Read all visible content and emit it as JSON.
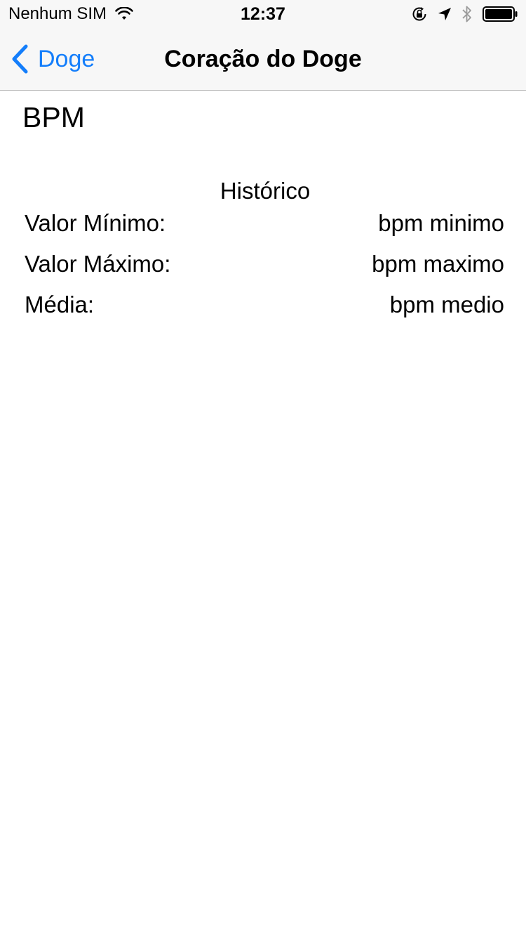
{
  "status_bar": {
    "carrier": "Nenhum SIM",
    "time": "12:37",
    "icons": [
      "wifi-icon",
      "orientation-lock-icon",
      "location-arrow-icon",
      "bluetooth-icon",
      "battery-icon"
    ]
  },
  "nav": {
    "back_label": "Doge",
    "title": "Coração do Doge",
    "accent_color": "#147efb"
  },
  "main": {
    "bpm_label": "BPM",
    "history_title": "Histórico",
    "rows": [
      {
        "label": "Valor Mínimo:",
        "value": "bpm minimo"
      },
      {
        "label": "Valor Máximo:",
        "value": "bpm maximo"
      },
      {
        "label": "Média:",
        "value": "bpm medio"
      }
    ]
  }
}
